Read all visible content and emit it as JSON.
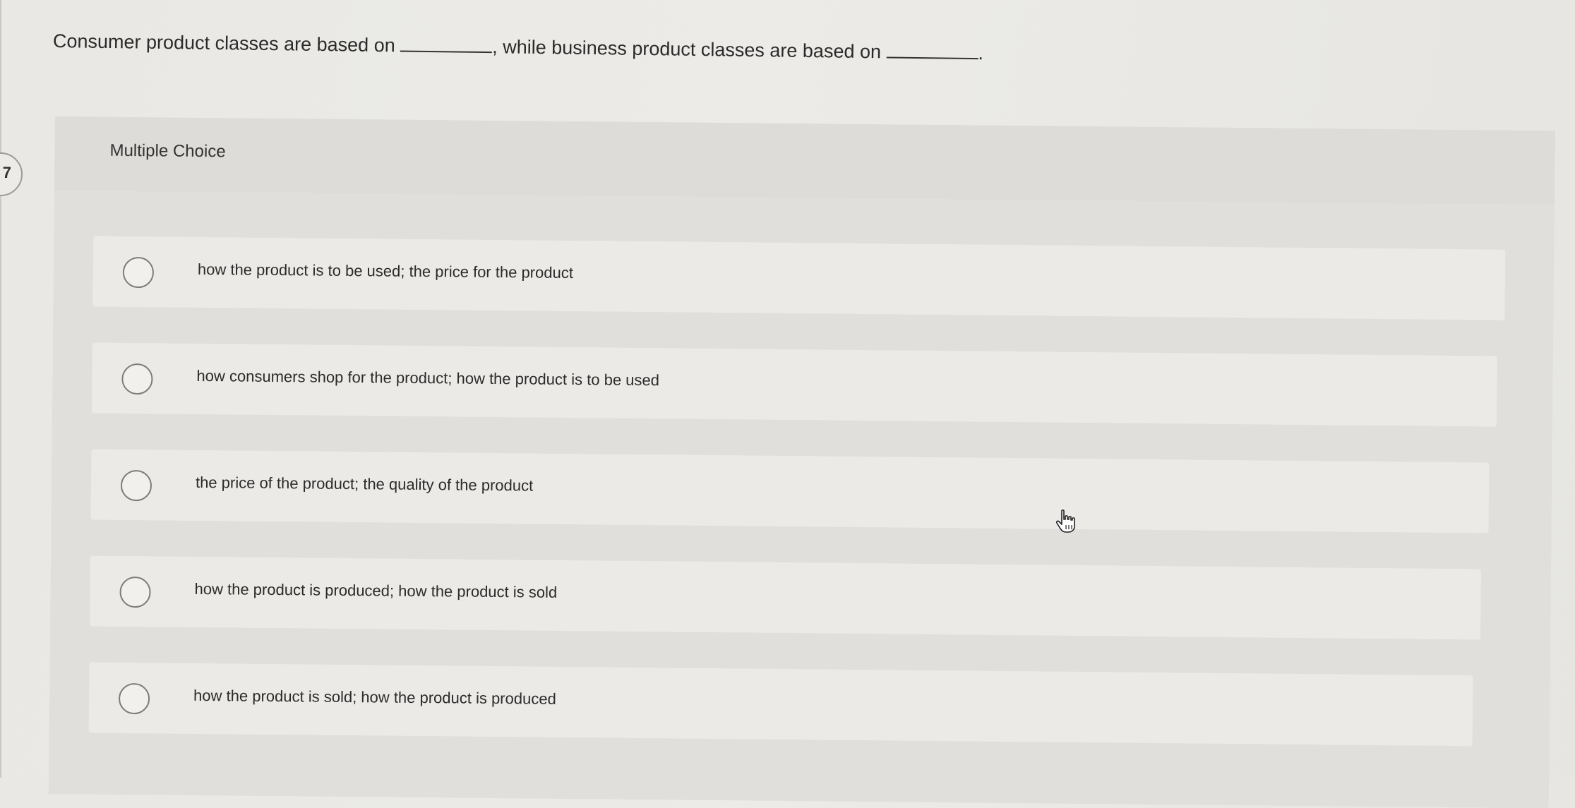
{
  "question": {
    "part1": "Consumer product classes are based on",
    "part2": ", while business product classes are based on",
    "part3": "."
  },
  "question_number_partial": "7",
  "section_label": "Multiple Choice",
  "options": [
    {
      "label": "how the product is to be used; the price for the product"
    },
    {
      "label": "how consumers shop for the product; how the product is to be used"
    },
    {
      "label": "the price of the product; the quality of the product"
    },
    {
      "label": "how the product is produced; how the product is sold"
    },
    {
      "label": "how the product is sold; how the product is produced"
    }
  ],
  "icons": {
    "radio": "radio-circle-icon",
    "cursor": "hand-pointer-icon"
  },
  "colors": {
    "background": "#ebeae6",
    "panel": "#e0dfdb",
    "option_row": "#ebeae6",
    "text": "#2b2b2b"
  }
}
